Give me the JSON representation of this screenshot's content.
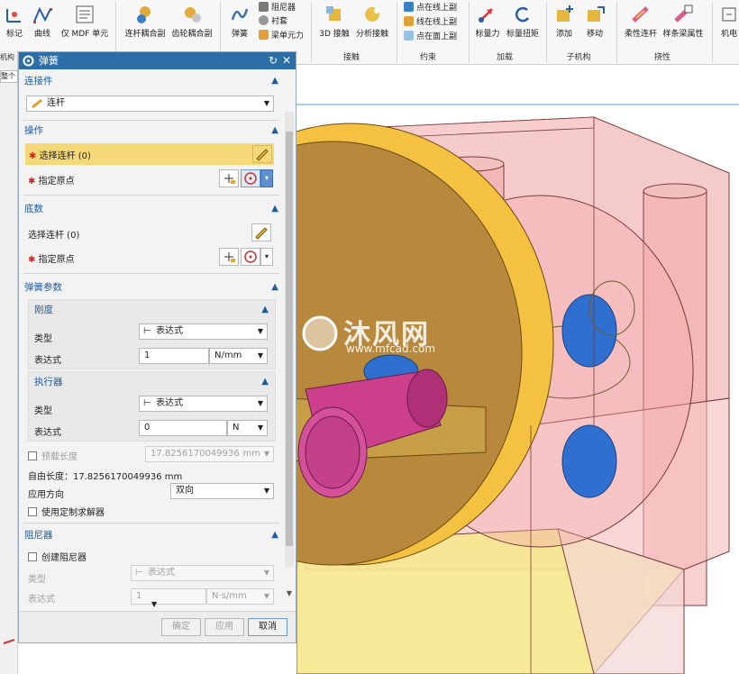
{
  "ribbon": {
    "buttons": [
      "标记",
      "曲线",
      "仅 MDF 单元",
      "连杆耦合副",
      "齿轮耦合副",
      "弹簧",
      "3D 接触",
      "分析接触",
      "标量力",
      "标量扭矩",
      "添加",
      "移动",
      "柔性连杆",
      "样条梁属性",
      "机电"
    ],
    "small_items": [
      "阻尼器",
      "衬套",
      "梁单元力",
      "点在线上副",
      "线在线上副",
      "点在面上副"
    ],
    "groups": [
      "接触",
      "约束",
      "加载",
      "子机构",
      "挠性"
    ],
    "left_stub": [
      "机构",
      "整个"
    ]
  },
  "dialog": {
    "title": "弹簧",
    "connector": {
      "header": "连接件",
      "value": "连杆"
    },
    "action": {
      "header": "操作",
      "select_link": "选择连杆 (0)",
      "specify_origin": "指定原点"
    },
    "base": {
      "header": "底数",
      "select_link": "选择连杆 (0)",
      "specify_origin": "指定原点"
    },
    "spring_params": {
      "header": "弹簧参数",
      "stiffness": {
        "header": "刚度",
        "type_label": "类型",
        "type_value": "表达式",
        "expr_label": "表达式",
        "expr_value": "1",
        "unit": "N/mm"
      },
      "actuator": {
        "header": "执行器",
        "type_label": "类型",
        "type_value": "表达式",
        "expr_label": "表达式",
        "expr_value": "0",
        "unit": "N"
      },
      "preload_label": "预载长度",
      "preload_value": "17.8256170049936",
      "preload_unit": "mm",
      "free_length": "自由长度：17.8256170049936 mm",
      "direction_label": "应用方向",
      "direction_value": "双向",
      "custom_solver": "使用定制求解器"
    },
    "damper": {
      "header": "阻尼器",
      "create": "创建阻尼器",
      "type_label": "类型",
      "type_value": "表达式",
      "expr_label": "表达式",
      "expr_value": "1",
      "unit": "N·s/mm"
    },
    "buttons": {
      "ok": "确定",
      "apply": "应用",
      "cancel": "取消"
    }
  },
  "watermark": {
    "brand": "沐风网",
    "url": "www.mfcad.com"
  },
  "colors": {
    "title_bar": "#2b6ea8",
    "section_header": "#1c5da0",
    "highlight_row": "#f5d978",
    "required_star": "#d0231b"
  }
}
